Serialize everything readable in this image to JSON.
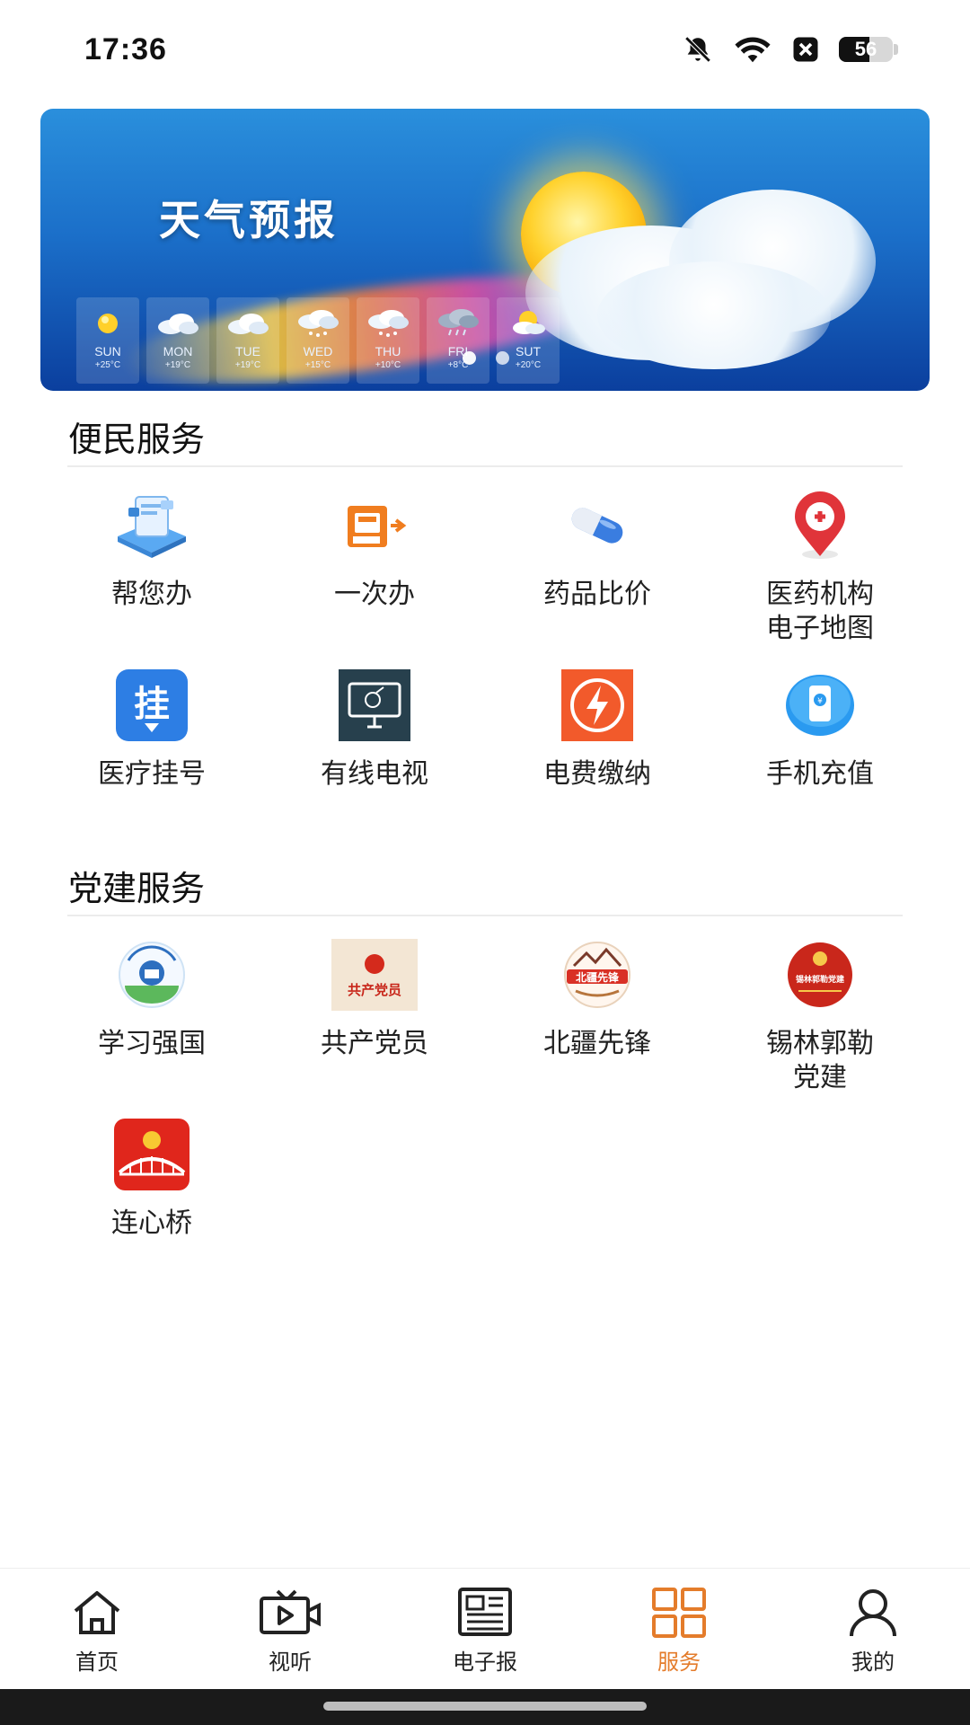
{
  "status_bar": {
    "time": "17:36",
    "battery_level": "56",
    "icons": [
      "bell-muted-icon",
      "wifi-icon",
      "notification-x-icon",
      "battery-icon"
    ]
  },
  "banner": {
    "title": "天气预报",
    "forecast": [
      {
        "day": "SUN",
        "temp": "+25°C",
        "icon": "sunny-icon"
      },
      {
        "day": "MON",
        "temp": "+19°C",
        "icon": "cloudy-icon"
      },
      {
        "day": "TUE",
        "temp": "+19°C",
        "icon": "cloudy-icon"
      },
      {
        "day": "WED",
        "temp": "+15°C",
        "icon": "snow-cloud-icon"
      },
      {
        "day": "THU",
        "temp": "+10°C",
        "icon": "snow-cloud-icon"
      },
      {
        "day": "FRI",
        "temp": "+8°C",
        "icon": "rain-cloud-icon"
      },
      {
        "day": "SUT",
        "temp": "+20°C",
        "icon": "partly-sunny-icon"
      }
    ],
    "pager_total": 2,
    "pager_active": 1
  },
  "convenience": {
    "title": "便民服务",
    "items": [
      {
        "label": "帮您办",
        "icon": "help-service-icon"
      },
      {
        "label": "一次办",
        "icon": "one-stop-icon"
      },
      {
        "label": "药品比价",
        "icon": "pill-icon"
      },
      {
        "label": "医药机构\n电子地图",
        "icon": "medical-map-pin-icon"
      },
      {
        "label": "医疗挂号",
        "icon": "registration-icon"
      },
      {
        "label": "有线电视",
        "icon": "cable-tv-icon"
      },
      {
        "label": "电费缴纳",
        "icon": "electricity-bolt-icon"
      },
      {
        "label": "手机充值",
        "icon": "phone-topup-icon"
      }
    ]
  },
  "party": {
    "title": "党建服务",
    "items": [
      {
        "label": "学习强国",
        "icon": "xuexi-qiangguo-icon",
        "badge_text": ""
      },
      {
        "label": "共产党员",
        "icon": "party-member-icon",
        "badge_text": "共产党员"
      },
      {
        "label": "北疆先锋",
        "icon": "beijiang-pioneer-icon",
        "badge_text": "北疆先锋"
      },
      {
        "label": "锡林郭勒\n党建",
        "icon": "xilingol-party-icon",
        "badge_text": "锡林郭勒党建"
      },
      {
        "label": "连心桥",
        "icon": "lianxin-bridge-icon",
        "badge_text": ""
      }
    ]
  },
  "tabbar": {
    "tabs": [
      {
        "label": "首页",
        "icon": "home-icon"
      },
      {
        "label": "视听",
        "icon": "video-tv-icon"
      },
      {
        "label": "电子报",
        "icon": "newspaper-icon"
      },
      {
        "label": "服务",
        "icon": "grid-services-icon"
      },
      {
        "label": "我的",
        "icon": "user-icon"
      }
    ],
    "active": "服务",
    "accent_color": "#e47c2b"
  }
}
